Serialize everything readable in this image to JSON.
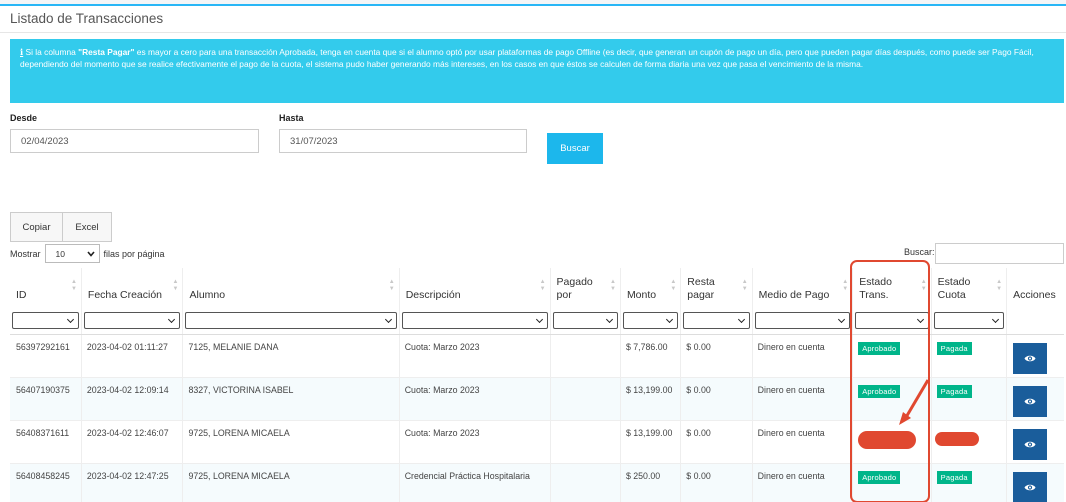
{
  "page": {
    "title": "Listado de Transacciones"
  },
  "alert": {
    "icon": "info-icon",
    "prefix": "Si la columna ",
    "highlight": "\"Resta Pagar\"",
    "body": " es mayor a cero para una transacción Aprobada, tenga en cuenta que si el alumno optó por usar plataformas de pago Offline (es decir, que generan un cupón de pago un día, pero que pueden pagar días después, como puede ser Pago Fácil, dependiendo del momento que se realice efectivamente el pago de la cuota, el sistema pudo haber generando más intereses, en los casos en que éstos se calculen de forma diaria una vez que pasa el vencimiento de la misma."
  },
  "filters": {
    "desde_label": "Desde",
    "desde_value": "02/04/2023",
    "hasta_label": "Hasta",
    "hasta_value": "31/07/2023",
    "buscar_button": "Buscar"
  },
  "export": {
    "copy": "Copiar",
    "excel": "Excel"
  },
  "length": {
    "prefix": "Mostrar",
    "value": "10",
    "suffix": "filas por página"
  },
  "search": {
    "label": "Buscar:",
    "value": ""
  },
  "columns": [
    "ID",
    "Fecha Creación",
    "Alumno",
    "Descripción",
    "Pagado por",
    "Monto",
    "Resta pagar",
    "Medio de Pago",
    "Estado Trans.",
    "Estado Cuota",
    "Acciones"
  ],
  "rows": [
    {
      "id": "56397292161",
      "fecha": "2023-04-02 01:11:27",
      "alumno": "7125, MELANIE DANA",
      "descripcion": "Cuota: Marzo 2023",
      "pagado_por": "",
      "monto": "$ 7,786.00",
      "resta": "$ 0.00",
      "medio": "Dinero en cuenta",
      "estado_trans": "Aprobado",
      "estado_cuota": "Pagada",
      "redacted": false
    },
    {
      "id": "56407190375",
      "fecha": "2023-04-02 12:09:14",
      "alumno": "8327, VICTORINA ISABEL",
      "descripcion": "Cuota: Marzo 2023",
      "pagado_por": "",
      "monto": "$ 13,199.00",
      "resta": "$ 0.00",
      "medio": "Dinero en cuenta",
      "estado_trans": "Aprobado",
      "estado_cuota": "Pagada",
      "redacted": false
    },
    {
      "id": "56408371611",
      "fecha": "2023-04-02 12:46:07",
      "alumno": "9725, LORENA MICAELA",
      "descripcion": "Cuota: Marzo 2023",
      "pagado_por": "",
      "monto": "$ 13,199.00",
      "resta": "$ 0.00",
      "medio": "Dinero en cuenta",
      "estado_trans": "",
      "estado_cuota": "",
      "redacted": true
    },
    {
      "id": "56408458245",
      "fecha": "2023-04-02 12:47:25",
      "alumno": "9725, LORENA MICAELA",
      "descripcion": "Credencial Práctica Hospitalaria",
      "pagado_por": "",
      "monto": "$ 250.00",
      "resta": "$ 0.00",
      "medio": "Dinero en cuenta",
      "estado_trans": "Aprobado",
      "estado_cuota": "Pagada",
      "redacted": false
    }
  ],
  "colors": {
    "accent": "#33cbec",
    "button": "#1cb7ec",
    "badge": "#00b58a",
    "action": "#1a5d9b",
    "annotation": "#e04830"
  }
}
